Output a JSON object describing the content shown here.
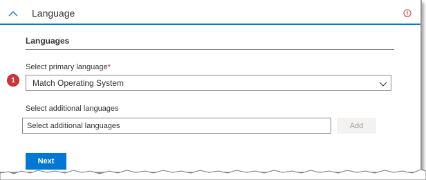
{
  "section": {
    "title": "Language",
    "collapse_icon": "chevron-up-icon",
    "status_icon": "warning-circle-icon",
    "status_color": "#d13438",
    "accent_color": "#0078d4"
  },
  "languages": {
    "heading": "Languages",
    "primary": {
      "label": "Select primary language",
      "required_marker": "*",
      "value": "Match Operating System",
      "step_badge": "1"
    },
    "additional": {
      "label": "Select additional languages",
      "placeholder": "Select additional languages",
      "add_label": "Add"
    }
  },
  "footer": {
    "next_label": "Next"
  }
}
